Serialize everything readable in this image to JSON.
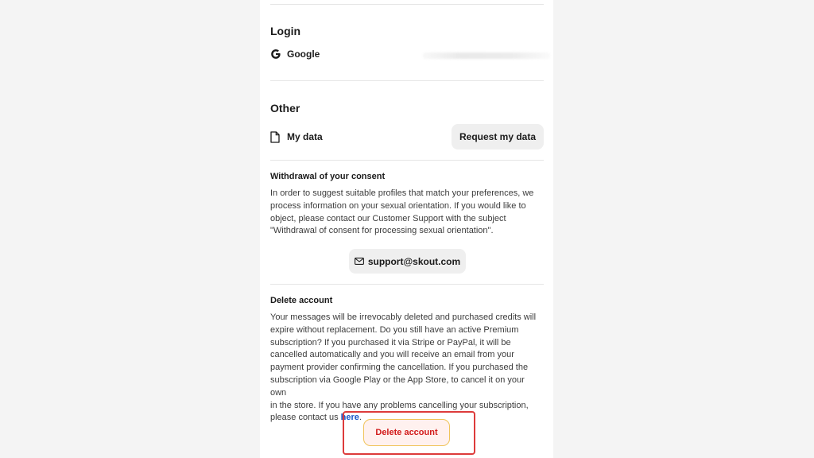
{
  "login": {
    "title": "Login",
    "provider_label": "Google",
    "provider_icon": "google-g-icon"
  },
  "other": {
    "title": "Other",
    "my_data_label": "My data",
    "my_data_icon": "document-icon",
    "request_button": "Request my data"
  },
  "consent": {
    "heading": "Withdrawal of your consent",
    "lines": [
      "In order to suggest suitable profiles that match your preferences, we",
      "process information on your sexual orientation. If you would like to",
      "object, please contact our Customer Support with the subject",
      "\"Withdrawal of consent for processing sexual orientation\"."
    ],
    "email_button": "support@skout.com",
    "email_icon": "envelope-icon"
  },
  "delete": {
    "heading": "Delete account",
    "lines": [
      "Your messages will be irrevocably deleted and purchased credits will",
      "expire without replacement. Do you still have an active Premium",
      "subscription? If you purchased it via Stripe or PayPal, it will be",
      "cancelled automatically and you will receive an email from your",
      "payment provider confirming the cancellation. If you purchased the",
      "subscription via Google Play or the App Store, to cancel it on your own",
      "in the store. If you have any problems cancelling your subscription,"
    ],
    "last_line_prefix": "please contact us ",
    "link_text": "here",
    "last_line_suffix": ".",
    "button": "Delete account"
  },
  "colors": {
    "delete_text": "#d11a1a",
    "delete_border": "#f0c45a",
    "highlight_border": "#dd3b3b",
    "link": "#1a56c8"
  }
}
